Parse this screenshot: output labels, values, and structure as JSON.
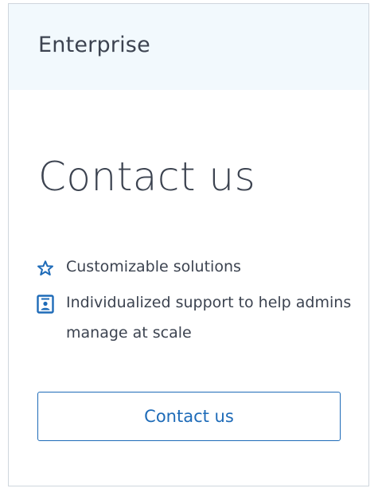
{
  "card": {
    "plan_name": "Enterprise",
    "price_label": "Contact us",
    "features": [
      {
        "icon": "star-outline-icon",
        "text": "Customizable solutions"
      },
      {
        "icon": "admin-badge-icon",
        "text": "Individualized support to help admins manage at scale"
      }
    ],
    "cta_label": "Contact us"
  },
  "colors": {
    "accent": "#1e6bb8",
    "header_bg": "#f2f9fd",
    "text": "#3c4350",
    "border": "#cfd6dd"
  }
}
